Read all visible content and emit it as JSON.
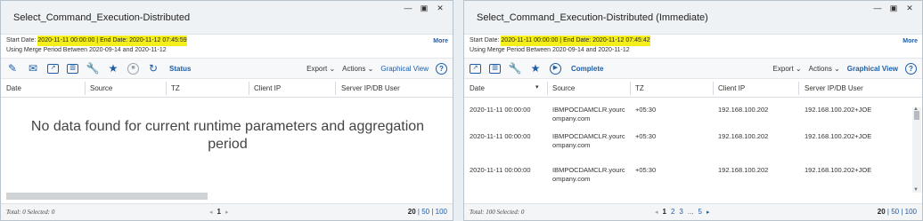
{
  "left": {
    "title": "Select_Command_Execution-Distributed",
    "start_label": "Start Date: ",
    "date_range": "2020-11-11 00:00:00 | End Date: 2020-11-12 07:45:59",
    "merge_text": "Using Merge Period Between 2020-09-14 and 2020-11-12",
    "more": "More",
    "status": "Status",
    "export": "Export",
    "actions": "Actions",
    "graphical_view": "Graphical View",
    "columns": [
      "Date",
      "Source",
      "TZ",
      "Client IP",
      "Server IP/DB User"
    ],
    "no_data": "No data found for current runtime parameters and aggregation period",
    "total": "Total: 0 Selected: 0",
    "current_page": "1",
    "size_current": "20",
    "size_options": " | 50 | 100"
  },
  "right": {
    "title": "Select_Command_Execution-Distributed (Immediate)",
    "start_label": "Start Date: ",
    "date_range": "2020-11-11 00:00:00 | End Date: 2020-11-12 07:45:42",
    "merge_text": "Using Merge Period Between 2020-09-14 and 2020-11-12",
    "more": "More",
    "complete": "Complete",
    "export": "Export",
    "actions": "Actions",
    "graphical_view": "Graphical View",
    "columns": [
      "Date",
      "Source",
      "TZ",
      "Client IP",
      "Server IP/DB User"
    ],
    "rows": [
      {
        "date": "2020-11-11 00:00:00",
        "source": "IBMPOCDAMCLR.yourcompany.com",
        "tz": "+05:30",
        "client_ip": "192.168.100.202",
        "server": "192.168.100.202+JOE"
      },
      {
        "date": "2020-11-11 00:00:00",
        "source": "IBMPOCDAMCLR.yourcompany.com",
        "tz": "+05:30",
        "client_ip": "192.168.100.202",
        "server": "192.168.100.202+JOE"
      },
      {
        "date": "2020-11-11 00:00:00",
        "source": "IBMPOCDAMCLR.yourcompany.com",
        "tz": "+05:30",
        "client_ip": "192.168.100.202",
        "server": "192.168.100.202+JOE"
      }
    ],
    "total": "Total: 100 Selected: 0",
    "pages": [
      "1",
      "2",
      "3",
      "...",
      "5"
    ],
    "size_current": "20",
    "size_options": " | 50 | 100"
  },
  "colors": {
    "accent": "#1f5da6",
    "highlight": "#f4ef1c"
  },
  "icons": [
    "pencil-icon",
    "envelope-icon",
    "export-window-icon",
    "columns-icon",
    "wrench-icon",
    "star-icon",
    "stop-icon",
    "refresh-icon",
    "play-icon",
    "help-icon"
  ]
}
